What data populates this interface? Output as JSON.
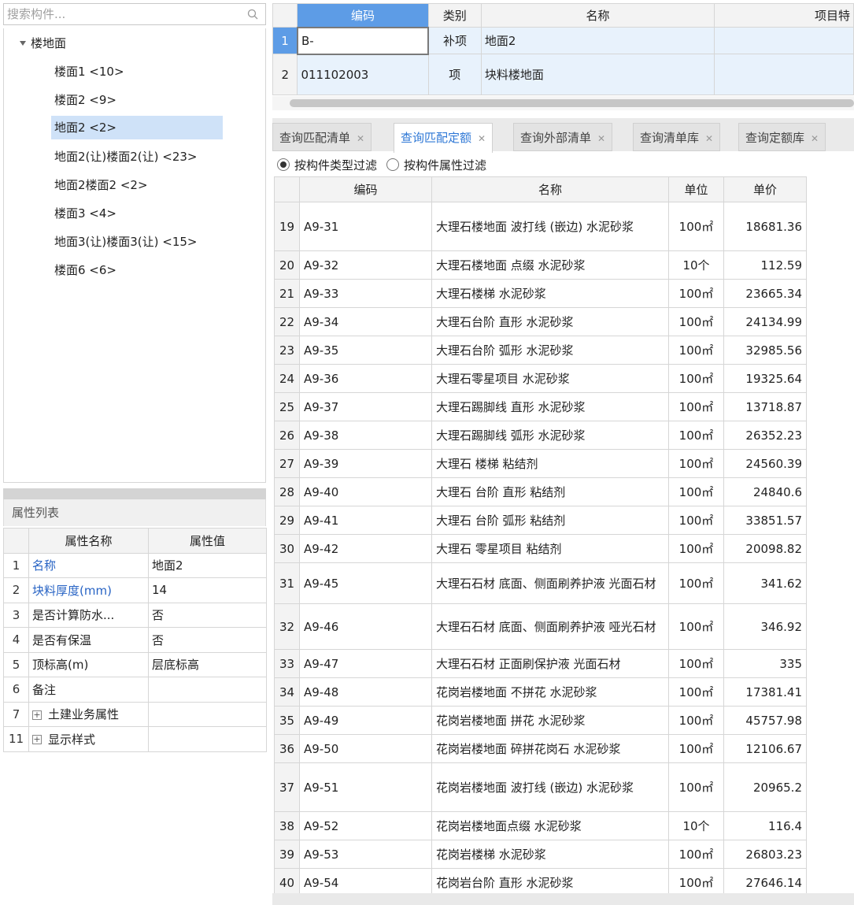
{
  "search": {
    "placeholder": "搜索构件..."
  },
  "tree": {
    "root": "楼地面",
    "items": [
      "楼面1 <10>",
      "楼面2 <9>",
      "地面2 <2>",
      "地面2(让)楼面2(让) <23>",
      "地面2楼面2 <2>",
      "楼面3 <4>",
      "地面3(让)楼面3(让) <15>",
      "楼面6 <6>"
    ],
    "selected_index": 2
  },
  "props": {
    "title": "属性列表",
    "headers": [
      "属性名称",
      "属性值"
    ],
    "rows": [
      {
        "num": "1",
        "name": "名称",
        "value": "地面2"
      },
      {
        "num": "2",
        "name": "块料厚度(mm)",
        "value": "14"
      },
      {
        "num": "3",
        "name": "是否计算防水...",
        "value": "否"
      },
      {
        "num": "4",
        "name": "是否有保温",
        "value": "否"
      },
      {
        "num": "5",
        "name": "顶标高(m)",
        "value": "层底标高"
      },
      {
        "num": "6",
        "name": "备注",
        "value": ""
      },
      {
        "num": "7",
        "name": "土建业务属性",
        "value": ""
      },
      {
        "num": "11",
        "name": "显示样式",
        "value": ""
      }
    ]
  },
  "top_table": {
    "headers": [
      "编码",
      "类别",
      "名称",
      "项目特"
    ],
    "rows": [
      {
        "num": "1",
        "code": "B-",
        "type": "补项",
        "name": "地面2"
      },
      {
        "num": "2",
        "code": "011102003",
        "type": "项",
        "name": "块料楼地面"
      }
    ]
  },
  "tabs": [
    "查询匹配清单",
    "查询匹配定额",
    "查询外部清单",
    "查询清单库",
    "查询定额库"
  ],
  "active_tab": 1,
  "filters": [
    "按构件类型过滤",
    "按构件属性过滤"
  ],
  "main_table": {
    "headers": [
      "编码",
      "名称",
      "单位",
      "单价"
    ],
    "rows": [
      {
        "num": "19",
        "code": "A9-31",
        "name": "大理石楼地面 波打线 (嵌边) 水泥砂浆",
        "unit": "100㎡",
        "price": "18681.36"
      },
      {
        "num": "20",
        "code": "A9-32",
        "name": "大理石楼地面 点缀 水泥砂浆",
        "unit": "10个",
        "price": "112.59"
      },
      {
        "num": "21",
        "code": "A9-33",
        "name": "大理石楼梯 水泥砂浆",
        "unit": "100㎡",
        "price": "23665.34"
      },
      {
        "num": "22",
        "code": "A9-34",
        "name": "大理石台阶 直形 水泥砂浆",
        "unit": "100㎡",
        "price": "24134.99"
      },
      {
        "num": "23",
        "code": "A9-35",
        "name": "大理石台阶 弧形 水泥砂浆",
        "unit": "100㎡",
        "price": "32985.56"
      },
      {
        "num": "24",
        "code": "A9-36",
        "name": "大理石零星项目 水泥砂浆",
        "unit": "100㎡",
        "price": "19325.64"
      },
      {
        "num": "25",
        "code": "A9-37",
        "name": "大理石踢脚线 直形 水泥砂浆",
        "unit": "100㎡",
        "price": "13718.87"
      },
      {
        "num": "26",
        "code": "A9-38",
        "name": "大理石踢脚线 弧形 水泥砂浆",
        "unit": "100㎡",
        "price": "26352.23"
      },
      {
        "num": "27",
        "code": "A9-39",
        "name": "大理石 楼梯 粘结剂",
        "unit": "100㎡",
        "price": "24560.39"
      },
      {
        "num": "28",
        "code": "A9-40",
        "name": "大理石 台阶 直形 粘结剂",
        "unit": "100㎡",
        "price": "24840.6"
      },
      {
        "num": "29",
        "code": "A9-41",
        "name": "大理石 台阶 弧形 粘结剂",
        "unit": "100㎡",
        "price": "33851.57"
      },
      {
        "num": "30",
        "code": "A9-42",
        "name": "大理石 零星项目 粘结剂",
        "unit": "100㎡",
        "price": "20098.82"
      },
      {
        "num": "31",
        "code": "A9-45",
        "name": "大理石石材 底面、侧面刷养护液 光面石材",
        "unit": "100㎡",
        "price": "341.62"
      },
      {
        "num": "32",
        "code": "A9-46",
        "name": "大理石石材 底面、侧面刷养护液 哑光石材",
        "unit": "100㎡",
        "price": "346.92"
      },
      {
        "num": "33",
        "code": "A9-47",
        "name": "大理石石材 正面刷保护液 光面石材",
        "unit": "100㎡",
        "price": "335"
      },
      {
        "num": "34",
        "code": "A9-48",
        "name": "花岗岩楼地面 不拼花 水泥砂浆",
        "unit": "100㎡",
        "price": "17381.41"
      },
      {
        "num": "35",
        "code": "A9-49",
        "name": "花岗岩楼地面 拼花 水泥砂浆",
        "unit": "100㎡",
        "price": "45757.98"
      },
      {
        "num": "36",
        "code": "A9-50",
        "name": "花岗岩楼地面 碎拼花岗石 水泥砂浆",
        "unit": "100㎡",
        "price": "12106.67"
      },
      {
        "num": "37",
        "code": "A9-51",
        "name": "花岗岩楼地面 波打线 (嵌边) 水泥砂浆",
        "unit": "100㎡",
        "price": "20965.2"
      },
      {
        "num": "38",
        "code": "A9-52",
        "name": "花岗岩楼地面点缀 水泥砂浆",
        "unit": "10个",
        "price": "116.4"
      },
      {
        "num": "39",
        "code": "A9-53",
        "name": "花岗岩楼梯 水泥砂浆",
        "unit": "100㎡",
        "price": "26803.23"
      },
      {
        "num": "40",
        "code": "A9-54",
        "name": "花岗岩台阶 直形 水泥砂浆",
        "unit": "100㎡",
        "price": "27646.14"
      }
    ]
  }
}
